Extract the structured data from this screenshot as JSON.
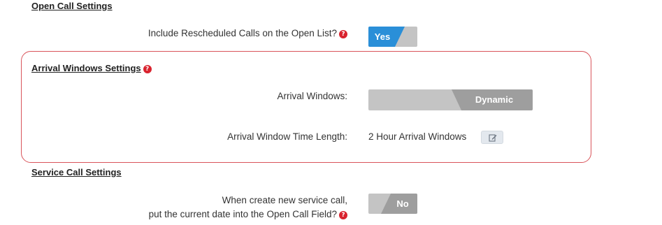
{
  "open_call_settings": {
    "heading": "Open Call Settings",
    "include_rescheduled_label": "Include Rescheduled Calls on the Open List?",
    "include_rescheduled_value": "Yes"
  },
  "arrival_windows_settings": {
    "heading": "Arrival Windows Settings",
    "arrival_windows_label": "Arrival Windows:",
    "arrival_windows_value": "Dynamic",
    "time_length_label": "Arrival Window Time Length:",
    "time_length_value": "2 Hour Arrival Windows"
  },
  "service_call_settings": {
    "heading": "Service Call Settings",
    "current_date_label_line1": "When create new service call,",
    "current_date_label_line2": "put the current date into the Open Call Field?",
    "current_date_value": "No"
  },
  "help_glyph": "?",
  "colors": {
    "toggle_on": "#2a8fd8",
    "toggle_off": "#c4c4c4",
    "toggle_active_dark": "#9e9e9e",
    "help_icon": "#d9232e",
    "highlight_border": "#d9545a"
  },
  "icons": {
    "help": "question-circle-icon",
    "edit": "edit-pencil-icon"
  }
}
